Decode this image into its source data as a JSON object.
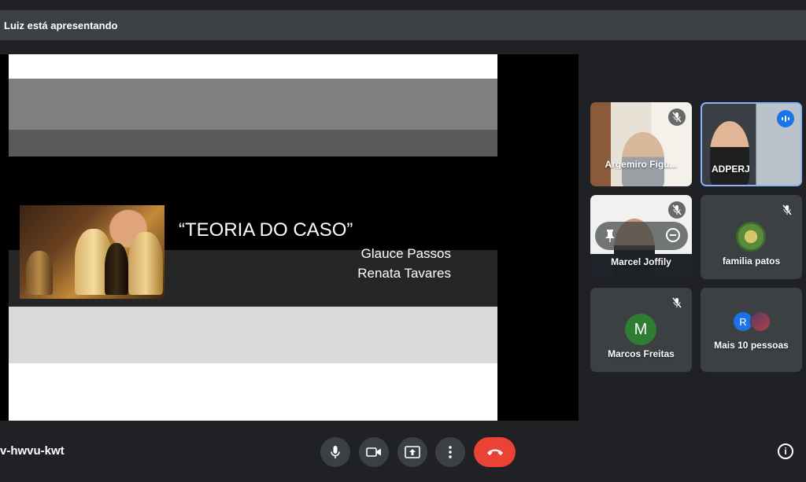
{
  "banner": {
    "text": "Luiz está apresentando"
  },
  "slide": {
    "title": "“TEORIA DO CASO”",
    "authors": [
      "Glauce Passos",
      "Renata Tavares"
    ]
  },
  "participants": [
    {
      "name": "Argemiro Figu...",
      "muted": true
    },
    {
      "name": "ADPERJ",
      "speaking": true
    },
    {
      "name": "Marcel Joffily",
      "muted": true
    },
    {
      "name": "familia patos",
      "muted": true
    },
    {
      "name": "Marcos Freitas",
      "avatar_letter": "M",
      "avatar_color": "#2e7d32",
      "muted": true
    },
    {
      "name": "Mais 10 pessoas",
      "avatar_letter": "R",
      "avatar_color": "#1a73e8"
    }
  ],
  "meeting": {
    "code_fragment": "v-hwvu-kwt"
  },
  "controls": {
    "mic": "mic-icon",
    "camera": "camera-icon",
    "present": "present-screen-icon",
    "more": "more-options-icon",
    "end_call": "end-call-icon",
    "info": "info-icon",
    "end_call_color": "#ea4335"
  }
}
